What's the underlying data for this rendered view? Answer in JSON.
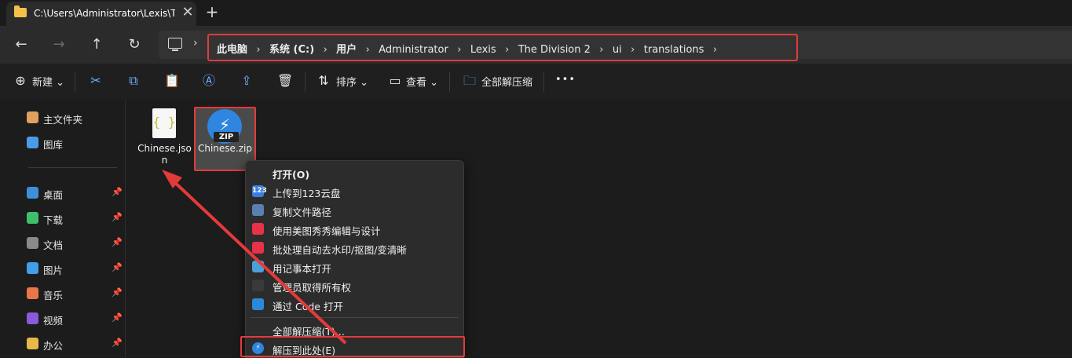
{
  "tab": {
    "title": "C:\\Users\\Administrator\\Lexis\\T",
    "close": "✕",
    "new_tab": "+"
  },
  "nav": {
    "back": "←",
    "forward": "→",
    "up": "↑",
    "refresh": "↻",
    "breadcrumb": [
      {
        "label": "此电脑",
        "bold": true
      },
      {
        "label": "系统 (C:)",
        "bold": true
      },
      {
        "label": "用户",
        "bold": true
      },
      {
        "label": "Administrator",
        "bold": false
      },
      {
        "label": "Lexis",
        "bold": false
      },
      {
        "label": "The Division 2",
        "bold": false
      },
      {
        "label": "ui",
        "bold": false
      },
      {
        "label": "translations",
        "bold": false
      }
    ],
    "separator": "›"
  },
  "toolbar": {
    "new_label": "新建",
    "sort_label": "排序",
    "view_label": "查看",
    "extract_all_label": "全部解压缩",
    "more": "•••"
  },
  "sidebar": {
    "top_items": [
      {
        "label": "主文件夹",
        "icon": "home-icon"
      },
      {
        "label": "图库",
        "icon": "gallery-icon"
      }
    ],
    "pinned_items": [
      {
        "label": "桌面",
        "icon": "desktop-icon"
      },
      {
        "label": "下载",
        "icon": "download-icon"
      },
      {
        "label": "文档",
        "icon": "document-icon"
      },
      {
        "label": "图片",
        "icon": "pictures-icon"
      },
      {
        "label": "音乐",
        "icon": "music-icon"
      },
      {
        "label": "视频",
        "icon": "video-icon"
      },
      {
        "label": "办公",
        "icon": "folder-icon"
      }
    ],
    "pin_glyph": "📌"
  },
  "files": [
    {
      "name": "Chinese.json",
      "type": "json",
      "icon_text": "{ }"
    },
    {
      "name": "Chinese.zip",
      "type": "zip",
      "icon_tag": "ZIP"
    }
  ],
  "context_menu": {
    "items": [
      {
        "label": "打开(O)",
        "icon": "none"
      },
      {
        "label": "上传到123云盘",
        "icon": "123-cloud-icon",
        "icon_text": "123"
      },
      {
        "label": "复制文件路径",
        "icon": "copy-path-icon"
      },
      {
        "label": "使用美图秀秀编辑与设计",
        "icon": "meitu-icon"
      },
      {
        "label": "批处理自动去水印/抠图/变清晰",
        "icon": "batch-edit-icon"
      },
      {
        "label": "用记事本打开",
        "icon": "notepad-icon"
      },
      {
        "label": "管理员取得所有权",
        "icon": "cmd-icon"
      },
      {
        "label": "通过 Code 打开",
        "icon": "vscode-icon"
      }
    ],
    "extract_all": "全部解压缩(T)...",
    "extract_here": "解压到此处(E)"
  },
  "colors": {
    "highlight_red": "#e53a3a",
    "accent_blue": "#2f86e0",
    "background": "#1c1c1c"
  }
}
